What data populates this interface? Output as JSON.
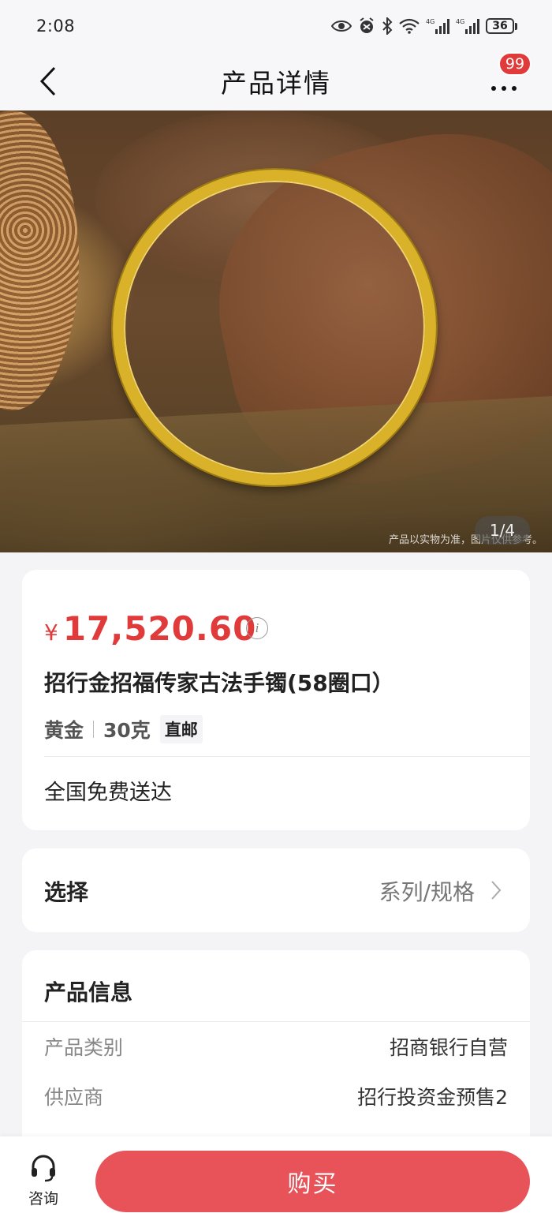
{
  "status_bar": {
    "time": "2:08",
    "battery": "36"
  },
  "nav": {
    "title": "产品详情",
    "badge": "99"
  },
  "gallery": {
    "counter": "1/4",
    "caption": "产品以实物为准，图片仅供参考。"
  },
  "product": {
    "currency": "¥",
    "price": "17,520.60",
    "name": "招行金招福传家古法手镯(58圈口）",
    "material": "黄金",
    "weight": "30克",
    "shipping_tag": "直邮",
    "delivery": "全国免费送达"
  },
  "select": {
    "label": "选择",
    "value": "系列/规格"
  },
  "info": {
    "title": "产品信息",
    "rows": [
      {
        "key": "产品类别",
        "value": "招商银行自营"
      },
      {
        "key": "供应商",
        "value": "招行投资金预售2"
      }
    ]
  },
  "bottom": {
    "consult_label": "咨询",
    "buy_label": "购买"
  },
  "colors": {
    "accent": "#e03a3a",
    "buy_button": "#e8535a",
    "gold": "#d9b22a"
  }
}
